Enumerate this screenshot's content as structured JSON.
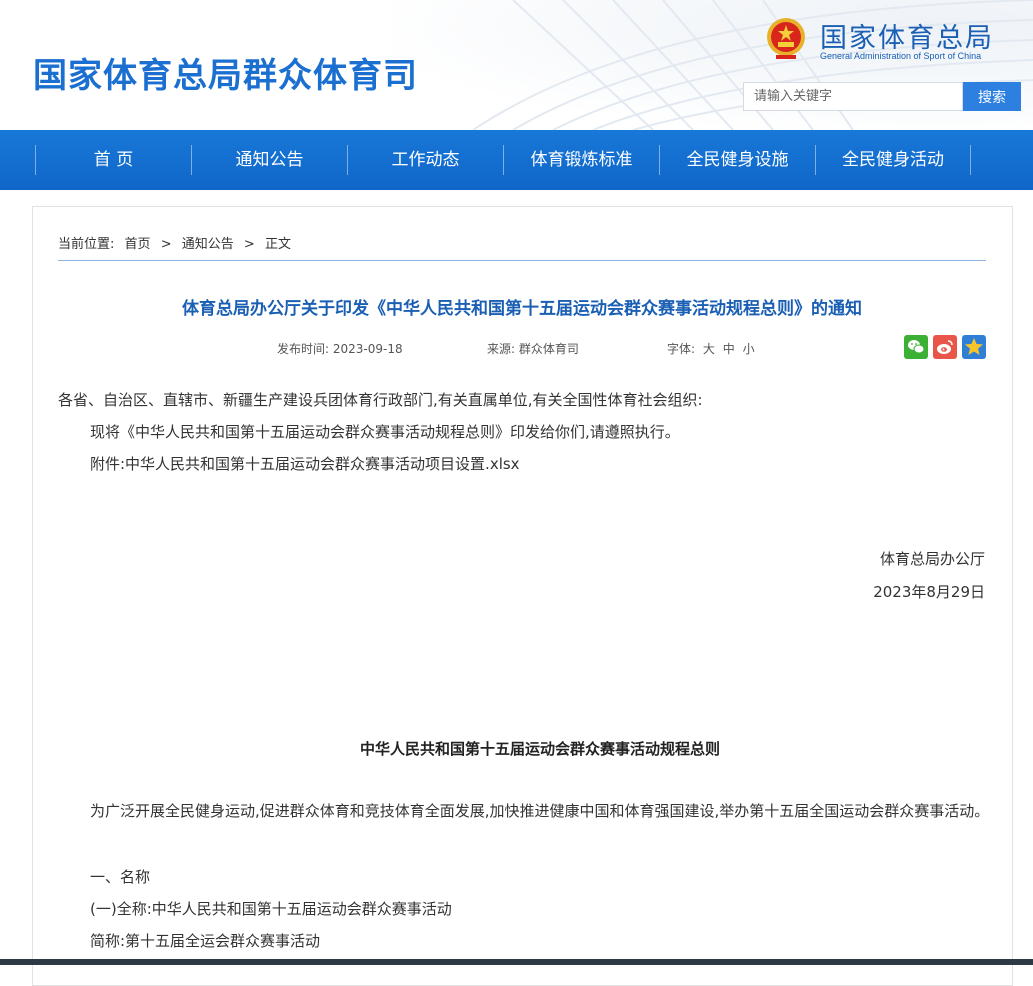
{
  "header": {
    "site_title": "国家体育总局群众体育司",
    "logo_cn": "国家体育总局",
    "logo_en": "General Administration of Sport of China",
    "search_placeholder": "请输入关键字",
    "search_button": "搜索"
  },
  "nav": {
    "items": [
      {
        "label": "首 页"
      },
      {
        "label": "通知公告"
      },
      {
        "label": "工作动态"
      },
      {
        "label": "体育锻炼标准"
      },
      {
        "label": "全民健身设施"
      },
      {
        "label": "全民健身活动"
      }
    ]
  },
  "breadcrumb": {
    "prefix": "当前位置:",
    "items": [
      "首页",
      ">",
      "通知公告",
      ">",
      "正文"
    ]
  },
  "article": {
    "title": "体育总局办公厅关于印发《中华人民共和国第十五届运动会群众赛事活动规程总则》的通知",
    "publish_label": "发布时间:",
    "publish_date": "2023-09-18",
    "source_label": "来源:",
    "source": "群众体育司",
    "font_label": "字体:",
    "font_sizes": [
      "大",
      "中",
      "小"
    ],
    "share": {
      "wechat_color": "#3cb034",
      "weibo_color": "#e8564a",
      "favorite_color": "#2f7fd6"
    },
    "salutation": "各省、自治区、直辖市、新疆生产建设兵团体育行政部门,有关直属单位,有关全国性体育社会组织:",
    "line1": "现将《中华人民共和国第十五届运动会群众赛事活动规程总则》印发给你们,请遵照执行。",
    "attachment": "附件:中华人民共和国第十五届运动会群众赛事活动项目设置.xlsx",
    "signature": "体育总局办公厅",
    "sign_date": "2023年8月29日",
    "rules_title": "中华人民共和国第十五届运动会群众赛事活动规程总则",
    "paragraph1": "为广泛开展全民健身运动,促进群众体育和竞技体育全面发展,加快推进健康中国和体育强国建设,举办第十五届全国运动会群众赛事活动。",
    "section1": "一、名称",
    "item1": "(一)全称:中华人民共和国第十五届运动会群众赛事活动",
    "item2": "简称:第十五届全运会群众赛事活动"
  },
  "colors": {
    "brand_blue": "#1a6fd0",
    "nav_blue": "#1070d0",
    "title_blue": "#1a5fb4"
  }
}
